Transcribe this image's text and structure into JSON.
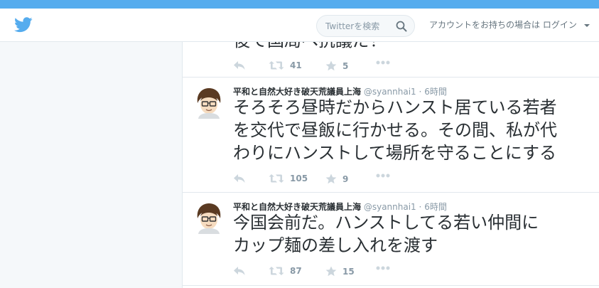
{
  "header": {
    "search_placeholder": "Twitterを検索",
    "account_prompt": "アカウントをお持ちの場合は",
    "login_label": "ログイン"
  },
  "tweets": [
    {
      "text_lines": [
        "後で国局へ抗議だ！"
      ],
      "retweets": "41",
      "favorites": "5"
    },
    {
      "name": "平和と自然大好き破天荒議員上海",
      "handle": "@syannhai1",
      "separator": "·",
      "time": "6時間",
      "text_lines": [
        "そろそろ昼時だからハンスト居ている若者",
        "を交代で昼飯に行かせる。その間、私が代",
        "わりにハンストして場所を守ることにする"
      ],
      "retweets": "105",
      "favorites": "9"
    },
    {
      "name": "平和と自然大好き破天荒議員上海",
      "handle": "@syannhai1",
      "separator": "·",
      "time": "6時間",
      "text_lines": [
        "今国会前だ。ハンストしてる若い仲間に",
        "カップ麺の差し入れを渡す"
      ],
      "retweets": "87",
      "favorites": "15"
    }
  ],
  "colors": {
    "brand": "#55acee",
    "text": "#292f33",
    "muted": "#8899a6",
    "border": "#e1e8ed"
  }
}
